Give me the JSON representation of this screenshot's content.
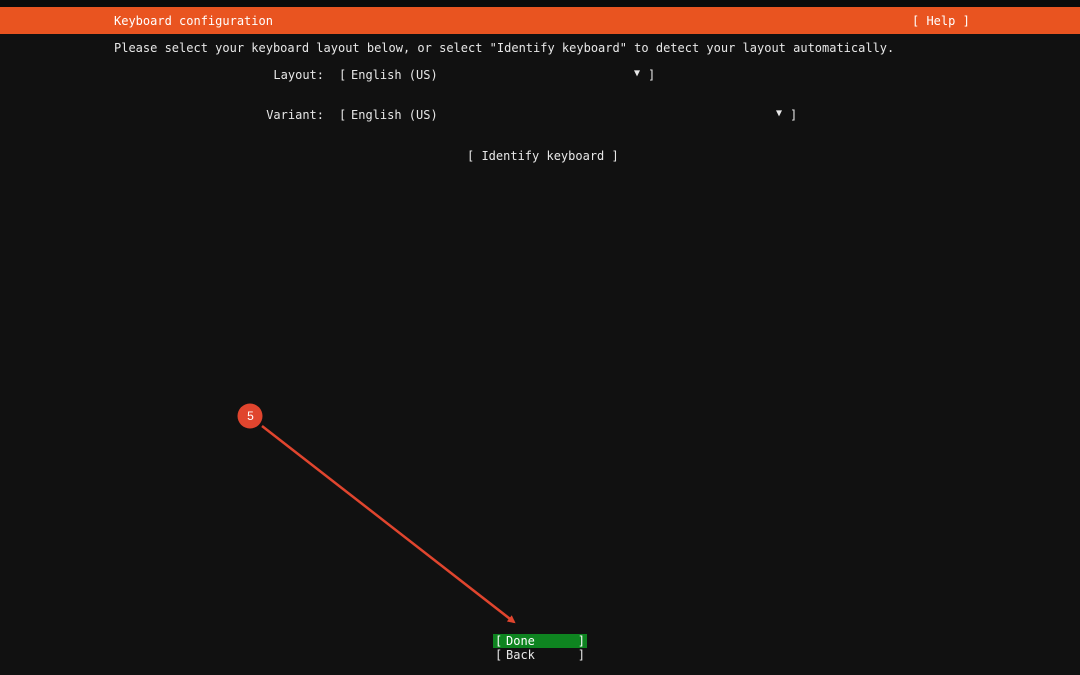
{
  "header": {
    "title": "Keyboard configuration",
    "help_label": "[ Help ]"
  },
  "instructions": "Please select your keyboard layout below, or select \"Identify keyboard\" to detect your layout automatically.",
  "layout": {
    "label": "Layout:",
    "value": "English (US)",
    "open_bracket": "[",
    "close_bracket": "]",
    "arrow": "▼"
  },
  "variant": {
    "label": "Variant:",
    "value": "English (US)",
    "open_bracket": "[",
    "close_bracket": "]",
    "arrow": "▼"
  },
  "identify_label": "[ Identify keyboard ]",
  "buttons": {
    "done": {
      "open": "[",
      "label": "Done",
      "close": "]"
    },
    "back": {
      "open": "[",
      "label": "Back",
      "close": "]"
    }
  },
  "annotation": {
    "step_number": "5",
    "color": "#e0452e"
  },
  "colors": {
    "header": "#e95420",
    "done_button": "#0e8420",
    "background": "#111111"
  }
}
